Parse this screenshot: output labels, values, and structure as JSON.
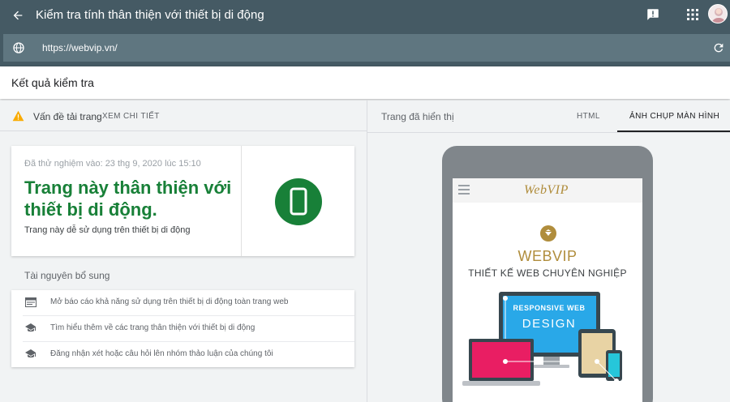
{
  "app": {
    "title": "Kiểm tra tính thân thiện với thiết bị di động",
    "url": "https://webvip.vn/",
    "icons": {
      "back": "arrow-back-icon",
      "feedback": "feedback-icon",
      "apps": "apps-grid-icon",
      "globe": "globe-icon",
      "reload": "reload-icon"
    }
  },
  "results": {
    "heading": "Kết quả kiểm tra"
  },
  "issues": {
    "label": "Vấn đề tải trang",
    "details_link": "XEM CHI TIẾT",
    "warning_color": "#f9ab00"
  },
  "verdict": {
    "tested_at": "Đã thử nghiệm vào: 23 thg 9, 2020 lúc 15:10",
    "headline": "Trang này thân thiện với thiết bị di động.",
    "subtext": "Trang này dễ sử dụng trên thiết bị di động",
    "color": "#188038"
  },
  "resources": {
    "title": "Tài nguyên bổ sung",
    "items": [
      {
        "icon": "report-icon",
        "label": "Mở báo cáo khả năng sử dụng trên thiết bị di động toàn trang web"
      },
      {
        "icon": "school-icon",
        "label": "Tìm hiểu thêm về các trang thân thiện với thiết bị di động"
      },
      {
        "icon": "school-icon",
        "label": "Đăng nhận xét hoặc câu hỏi lên nhóm thảo luận của chúng tôi"
      }
    ]
  },
  "preview": {
    "rendered_label": "Trang đã hiển thị",
    "tabs": [
      {
        "label": "HTML",
        "selected": false
      },
      {
        "label": "ẢNH CHỤP MÀN HÌNH",
        "selected": true
      }
    ],
    "site": {
      "logo": "WebVIP",
      "hero_title": "WEBVIP",
      "hero_subtitle": "THIẾT KẾ WEB CHUYÊN NGHIỆP",
      "illustration_line1": "RESPONSIVE WEB",
      "illustration_line2": "DESIGN",
      "brand_color": "#b08d3c"
    }
  }
}
